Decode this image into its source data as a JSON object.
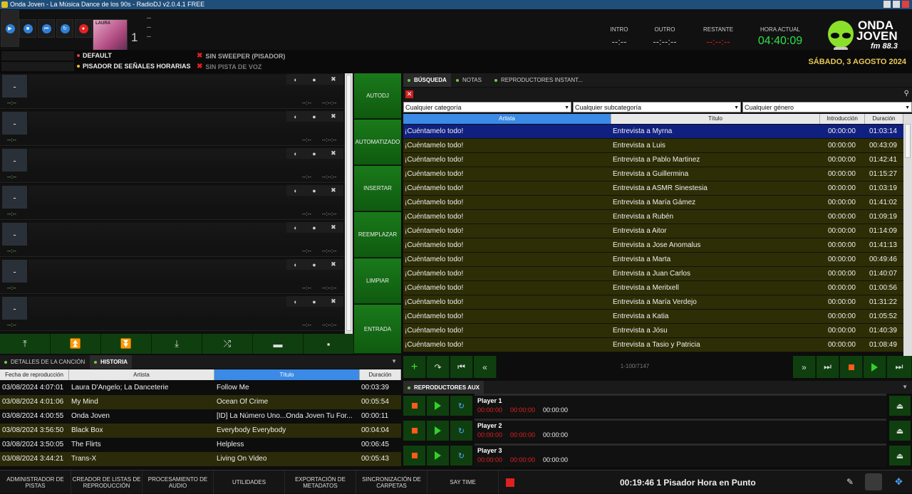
{
  "window": {
    "title": "Onda Joven - La Música Dance de los 90s - RadioDJ v2.0.4.1 FREE"
  },
  "deck": {
    "number": "1",
    "dash1": "--",
    "dash2": "--",
    "dash3": "--"
  },
  "timers": {
    "intro": {
      "label": "INTRO",
      "value": "--:--"
    },
    "outro": {
      "label": "OUTRO",
      "value": "--:--:--"
    },
    "remaining": {
      "label": "RESTANTE",
      "value": "--:--:--"
    },
    "clock": {
      "label": "HORA ACTUAL",
      "value": "04:40:09"
    }
  },
  "logo": {
    "line1": "ONDA",
    "line2": "JOVEN",
    "line3": "fm 88.3"
  },
  "cover": {
    "text": "LAURA"
  },
  "info": {
    "default": "DEFAULT",
    "time_signals": "PISADOR DE SEÑALES HORARIAS",
    "sweeper": "SIN SWEEPER (PISADOR)",
    "voice": "SIN PISTA DE VOZ",
    "date": "SÁBADO, 3 AGOSTO 2024"
  },
  "playlist_decks": [
    {
      "num": "-",
      "time_left": "--:--",
      "t1": "--:--",
      "t2": "--:--:--"
    },
    {
      "num": "-",
      "time_left": "--:--",
      "t1": "--:--",
      "t2": "--:--:--"
    },
    {
      "num": "-",
      "time_left": "--:--",
      "t1": "--:--",
      "t2": "--:--:--"
    },
    {
      "num": "-",
      "time_left": "--:--",
      "t1": "--:--",
      "t2": "--:--:--"
    },
    {
      "num": "-",
      "time_left": "--:--",
      "t1": "--:--",
      "t2": "--:--:--"
    },
    {
      "num": "-",
      "time_left": "--:--",
      "t1": "--:--",
      "t2": "--:--:--"
    },
    {
      "num": "-",
      "time_left": "--:--",
      "t1": "--:--",
      "t2": "--:--:--"
    }
  ],
  "side_buttons": [
    "AUTODJ",
    "AUTOMATIZADO",
    "INSERTAR",
    "REEMPLAZAR",
    "LIMPIAR",
    "ENTRADA"
  ],
  "history": {
    "tabs": [
      "DETALLES DE LA CANCIÓN",
      "HISTORIA"
    ],
    "columns": [
      "Fecha de reproducción",
      "Artista",
      "Título",
      "Duración"
    ],
    "rows": [
      {
        "date": "03/08/2024 4:07:01",
        "artist": "Laura D'Angelo;  La Danceterie",
        "title": "Follow Me",
        "dur": "00:03:39"
      },
      {
        "date": "03/08/2024 4:01:06",
        "artist": "My Mind",
        "title": "Ocean Of Crime",
        "dur": "00:05:54"
      },
      {
        "date": "03/08/2024 4:00:55",
        "artist": "Onda Joven",
        "title": "[ID] La Número Uno...Onda Joven Tu For...",
        "dur": "00:00:11"
      },
      {
        "date": "03/08/2024 3:56:50",
        "artist": "Black Box",
        "title": "Everybody Everybody",
        "dur": "00:04:04"
      },
      {
        "date": "03/08/2024 3:50:05",
        "artist": "The Flirts",
        "title": "Helpless",
        "dur": "00:06:45"
      },
      {
        "date": "03/08/2024 3:44:21",
        "artist": "Trans-X",
        "title": "Living On Video",
        "dur": "00:05:43"
      }
    ]
  },
  "search": {
    "tabs": [
      "BÚSQUEDA",
      "NOTAS",
      "REPRODUCTORES INSTANT..."
    ],
    "category": "Cualquier categoría",
    "subcategory": "Cualquier subcategoría",
    "genre": "Cualquier género",
    "columns": [
      "Artista",
      "Título",
      "Introducción",
      "Duración"
    ],
    "rows": [
      {
        "artist": "¡Cuéntamelo todo!",
        "title": "Entrevista a Myrna",
        "intro": "00:00:00",
        "dur": "01:03:14"
      },
      {
        "artist": "¡Cuéntamelo todo!",
        "title": "Entrevista a Luis",
        "intro": "00:00:00",
        "dur": "00:43:09"
      },
      {
        "artist": "¡Cuéntamelo todo!",
        "title": "Entrevista a Pablo Martinez",
        "intro": "00:00:00",
        "dur": "01:42:41"
      },
      {
        "artist": "¡Cuéntamelo todo!",
        "title": "Entrevista a Guillermina",
        "intro": "00:00:00",
        "dur": "01:15:27"
      },
      {
        "artist": "¡Cuéntamelo todo!",
        "title": "Entrevista a ASMR Sinestesia",
        "intro": "00:00:00",
        "dur": "01:03:19"
      },
      {
        "artist": "¡Cuéntamelo todo!",
        "title": "Entrevista a María Gámez",
        "intro": "00:00:00",
        "dur": "01:41:02"
      },
      {
        "artist": "¡Cuéntamelo todo!",
        "title": "Entrevista a Rubén",
        "intro": "00:00:00",
        "dur": "01:09:19"
      },
      {
        "artist": "¡Cuéntamelo todo!",
        "title": "Entrevista a Aitor",
        "intro": "00:00:00",
        "dur": "01:14:09"
      },
      {
        "artist": "¡Cuéntamelo todo!",
        "title": "Entrevista a Jose Anomalus",
        "intro": "00:00:00",
        "dur": "01:41:13"
      },
      {
        "artist": "¡Cuéntamelo todo!",
        "title": "Entrevista a Marta",
        "intro": "00:00:00",
        "dur": "00:49:46"
      },
      {
        "artist": "¡Cuéntamelo todo!",
        "title": "Entrevista a Juan Carlos",
        "intro": "00:00:00",
        "dur": "01:40:07"
      },
      {
        "artist": "¡Cuéntamelo todo!",
        "title": "Entrevista a Meritxell",
        "intro": "00:00:00",
        "dur": "01:00:56"
      },
      {
        "artist": "¡Cuéntamelo todo!",
        "title": "Entrevista a María Verdejo",
        "intro": "00:00:00",
        "dur": "01:31:22"
      },
      {
        "artist": "¡Cuéntamelo todo!",
        "title": "Entrevista a Katia",
        "intro": "00:00:00",
        "dur": "01:05:52"
      },
      {
        "artist": "¡Cuéntamelo todo!",
        "title": "Entrevista a Jósu",
        "intro": "00:00:00",
        "dur": "01:40:39"
      },
      {
        "artist": "¡Cuéntamelo todo!",
        "title": "Entrevista a Tasio y Patricia",
        "intro": "00:00:00",
        "dur": "01:08:49"
      }
    ],
    "counter": "1-100/7147"
  },
  "aux": {
    "tab": "REPRODUCTORES AUX",
    "players": [
      {
        "name": "Player 1",
        "t1": "00:00:00",
        "t2": "00:00:00",
        "t3": "00:00:00"
      },
      {
        "name": "Player 2",
        "t1": "00:00:00",
        "t2": "00:00:00",
        "t3": "00:00:00"
      },
      {
        "name": "Player 3",
        "t1": "00:00:00",
        "t2": "00:00:00",
        "t3": "00:00:00"
      }
    ]
  },
  "bottom": {
    "buttons": [
      "ADMINISTRADOR DE PISTAS",
      "CREADOR DE LISTAS DE REPRODUCCIÓN",
      "PROCESAMIENTO DE AUDIO",
      "UTILIDADES",
      "EXPORTACIÓN DE METADATOS",
      "SINCRONIZACIÓN DE CARPETAS",
      "SAY TIME"
    ],
    "now_playing": "00:19:46 1 Pisador Hora en Punto"
  },
  "colors": {
    "accent_green": "#2ee04a",
    "date_gold": "#e8c858",
    "selected_row": "#102080",
    "row_olive": "#2e2e06",
    "red": "#e02323"
  }
}
